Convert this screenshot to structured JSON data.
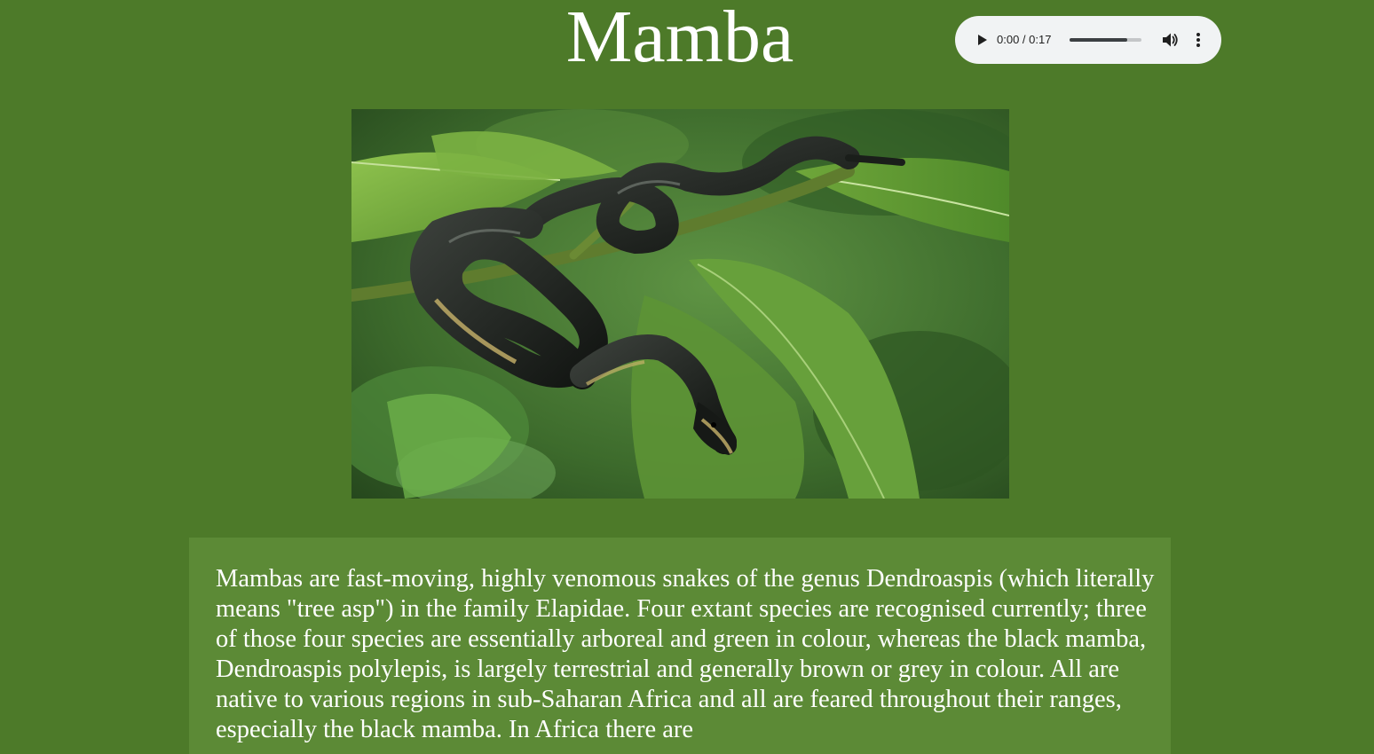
{
  "page": {
    "title": "Mamba"
  },
  "audio_player": {
    "time_display": "0:00 / 0:17",
    "progress_fraction": 0.0,
    "volume_fraction": 0.8,
    "icons": [
      "play-icon",
      "volume-icon",
      "more-options-icon"
    ]
  },
  "photo": {
    "subject": "black-snake-on-leaves"
  },
  "description": {
    "text": "Mambas are fast-moving, highly venomous snakes of the genus Dendroaspis (which literally means \"tree asp\") in the family Elapidae. Four extant species are recognised currently; three of those four species are essentially arboreal and green in colour, whereas the black mamba, Dendroaspis polylepis, is largely terrestrial and generally brown or grey in colour. All are native to various regions in sub-Saharan Africa and all are feared throughout their ranges, especially the black mamba. In Africa there are"
  },
  "colors": {
    "background": "#4d7a29",
    "description_box": "#5c8a36",
    "text": "#ffffff",
    "audio_player_bg": "#f1f3f4"
  }
}
